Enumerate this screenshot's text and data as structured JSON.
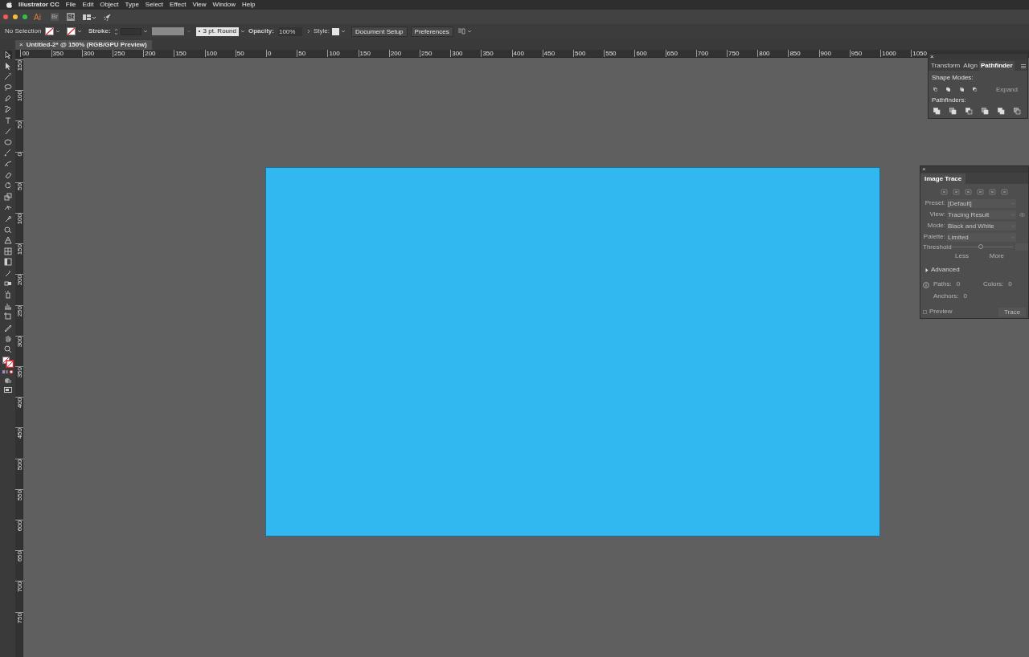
{
  "menu_bar": {
    "app_name": "Illustrator CC",
    "items": [
      "File",
      "Edit",
      "Object",
      "Type",
      "Select",
      "Effect",
      "View",
      "Window",
      "Help"
    ]
  },
  "app_bar": {
    "logo": "Ai",
    "badges": [
      "Br",
      "St"
    ]
  },
  "control_bar": {
    "selection": "No Selection",
    "stroke_label": "Stroke:",
    "brush": "3 pt. Round",
    "opacity_label": "Opacity:",
    "opacity": "100%",
    "style_label": "Style:",
    "buttons": [
      "Document Setup",
      "Preferences"
    ]
  },
  "document_tab": {
    "close": "×",
    "title": "Untitled-2* @ 150% (RGB/GPU Preview)"
  },
  "ruler": {
    "horizontal": [
      "00",
      "350",
      "300",
      "250",
      "200",
      "150",
      "100",
      "50",
      "0",
      "50",
      "100",
      "150",
      "200",
      "250",
      "300",
      "350",
      "400",
      "450",
      "500",
      "550",
      "600",
      "650",
      "700",
      "750",
      "800",
      "850",
      "900",
      "950",
      "1000",
      "1050"
    ],
    "vertical": [
      "150",
      "100",
      "50",
      "0",
      "50",
      "100",
      "150",
      "200",
      "250",
      "300",
      "350",
      "400",
      "450",
      "500",
      "550",
      "600",
      "650",
      "700",
      "750"
    ]
  },
  "pathfinder_panel": {
    "tabs": [
      {
        "label": "Transform",
        "selected": false
      },
      {
        "label": "Align",
        "selected": false
      },
      {
        "label": "Pathfinder",
        "selected": true
      }
    ],
    "shape_modes_label": "Shape Modes:",
    "expand": {
      "label": "Expand",
      "disabled": true
    },
    "pathfinders_label": "Pathfinders:"
  },
  "image_trace_panel": {
    "title": "Image Trace",
    "fields": [
      {
        "label": "Preset:",
        "value": "[Default]"
      },
      {
        "label": "View:",
        "value": "Tracing Result"
      },
      {
        "label": "Mode:",
        "value": "Black and White"
      },
      {
        "label": "Palette:",
        "value": "Limited"
      }
    ],
    "threshold": {
      "label": "Threshold",
      "level": 0.47,
      "less": "Less",
      "more": "More"
    },
    "advanced": {
      "label": "Advanced",
      "expanded": false
    },
    "stats": [
      {
        "label": "Paths:",
        "value": "0"
      },
      {
        "label": "Colors:",
        "value": "0"
      },
      {
        "label": "Anchors:",
        "value": "0"
      }
    ],
    "preview": {
      "label": "Preview",
      "checked": false
    },
    "trace": {
      "label": "Trace",
      "disabled": true
    }
  }
}
